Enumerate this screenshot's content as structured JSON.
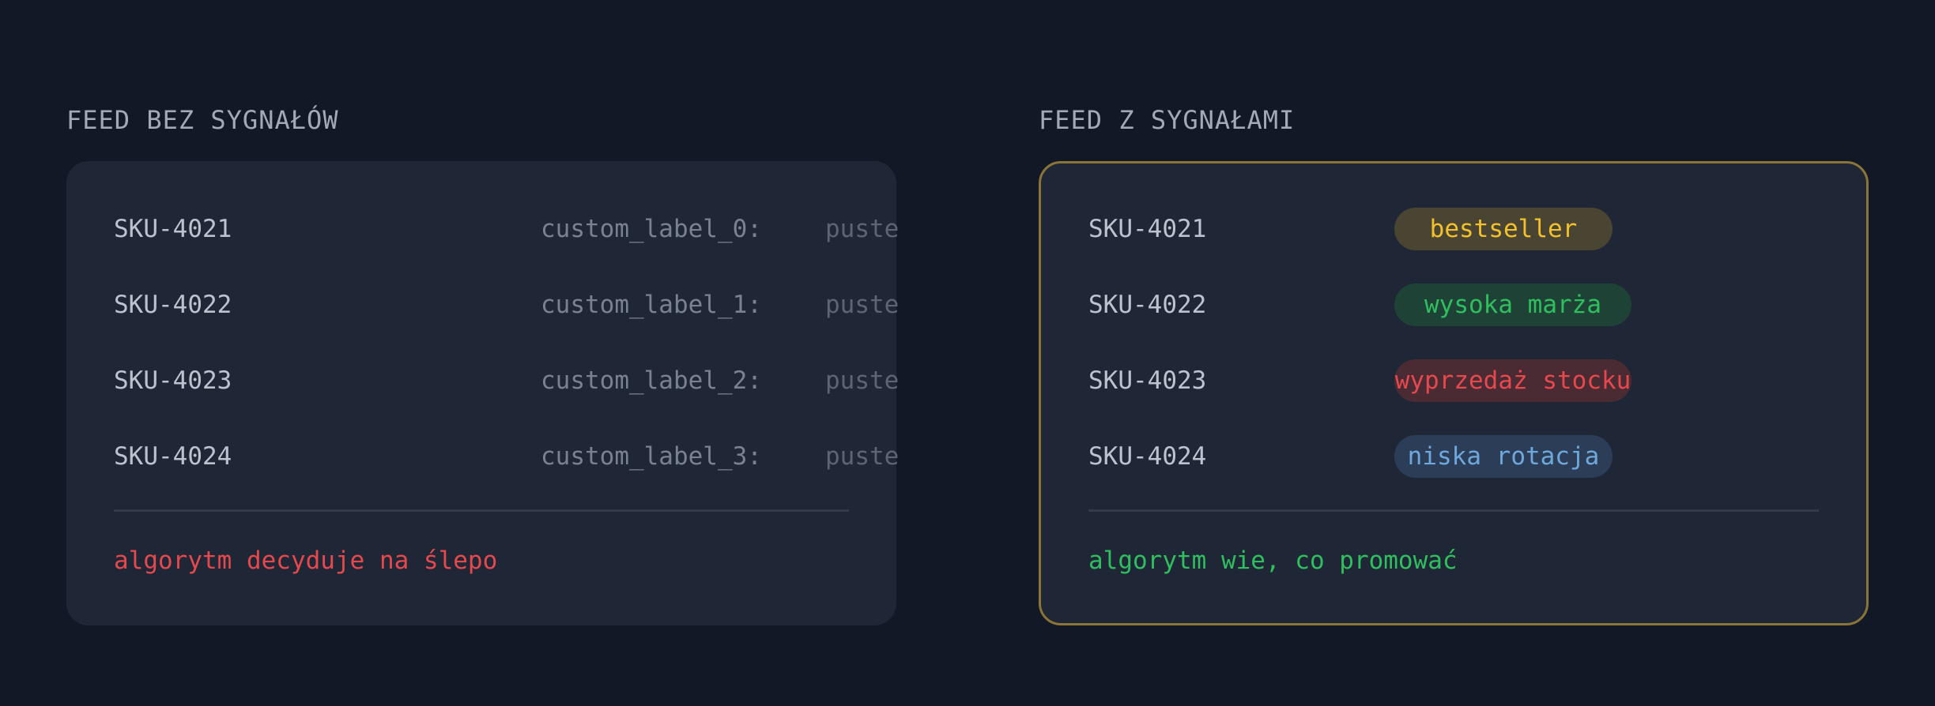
{
  "left_panel": {
    "title": "FEED BEZ SYGNAŁÓW",
    "rows": [
      {
        "sku": "SKU-4021",
        "label": "custom_label_0:",
        "value": "puste"
      },
      {
        "sku": "SKU-4022",
        "label": "custom_label_1:",
        "value": "puste"
      },
      {
        "sku": "SKU-4023",
        "label": "custom_label_2:",
        "value": "puste"
      },
      {
        "sku": "SKU-4024",
        "label": "custom_label_3:",
        "value": "puste"
      }
    ],
    "summary": "algorytm decyduje na ślepo"
  },
  "right_panel": {
    "title": "FEED Z SYGNAŁAMI",
    "rows": [
      {
        "sku": "SKU-4021",
        "badge": "bestseller"
      },
      {
        "sku": "SKU-4022",
        "badge": "wysoka marża"
      },
      {
        "sku": "SKU-4023",
        "badge": "wyprzedaż stocku"
      },
      {
        "sku": "SKU-4024",
        "badge": "niska rotacja"
      }
    ],
    "summary": "algorytm wie, co promować"
  },
  "colors": {
    "background": "#121826",
    "card": "#1f2737",
    "accent_border": "#8a7538",
    "bad": "#e5484d",
    "good": "#2fbf5f",
    "badge_yellow": "#f2c12e",
    "badge_green": "#2fbf5f",
    "badge_red": "#e5484d",
    "badge_blue": "#6ea8dc"
  }
}
